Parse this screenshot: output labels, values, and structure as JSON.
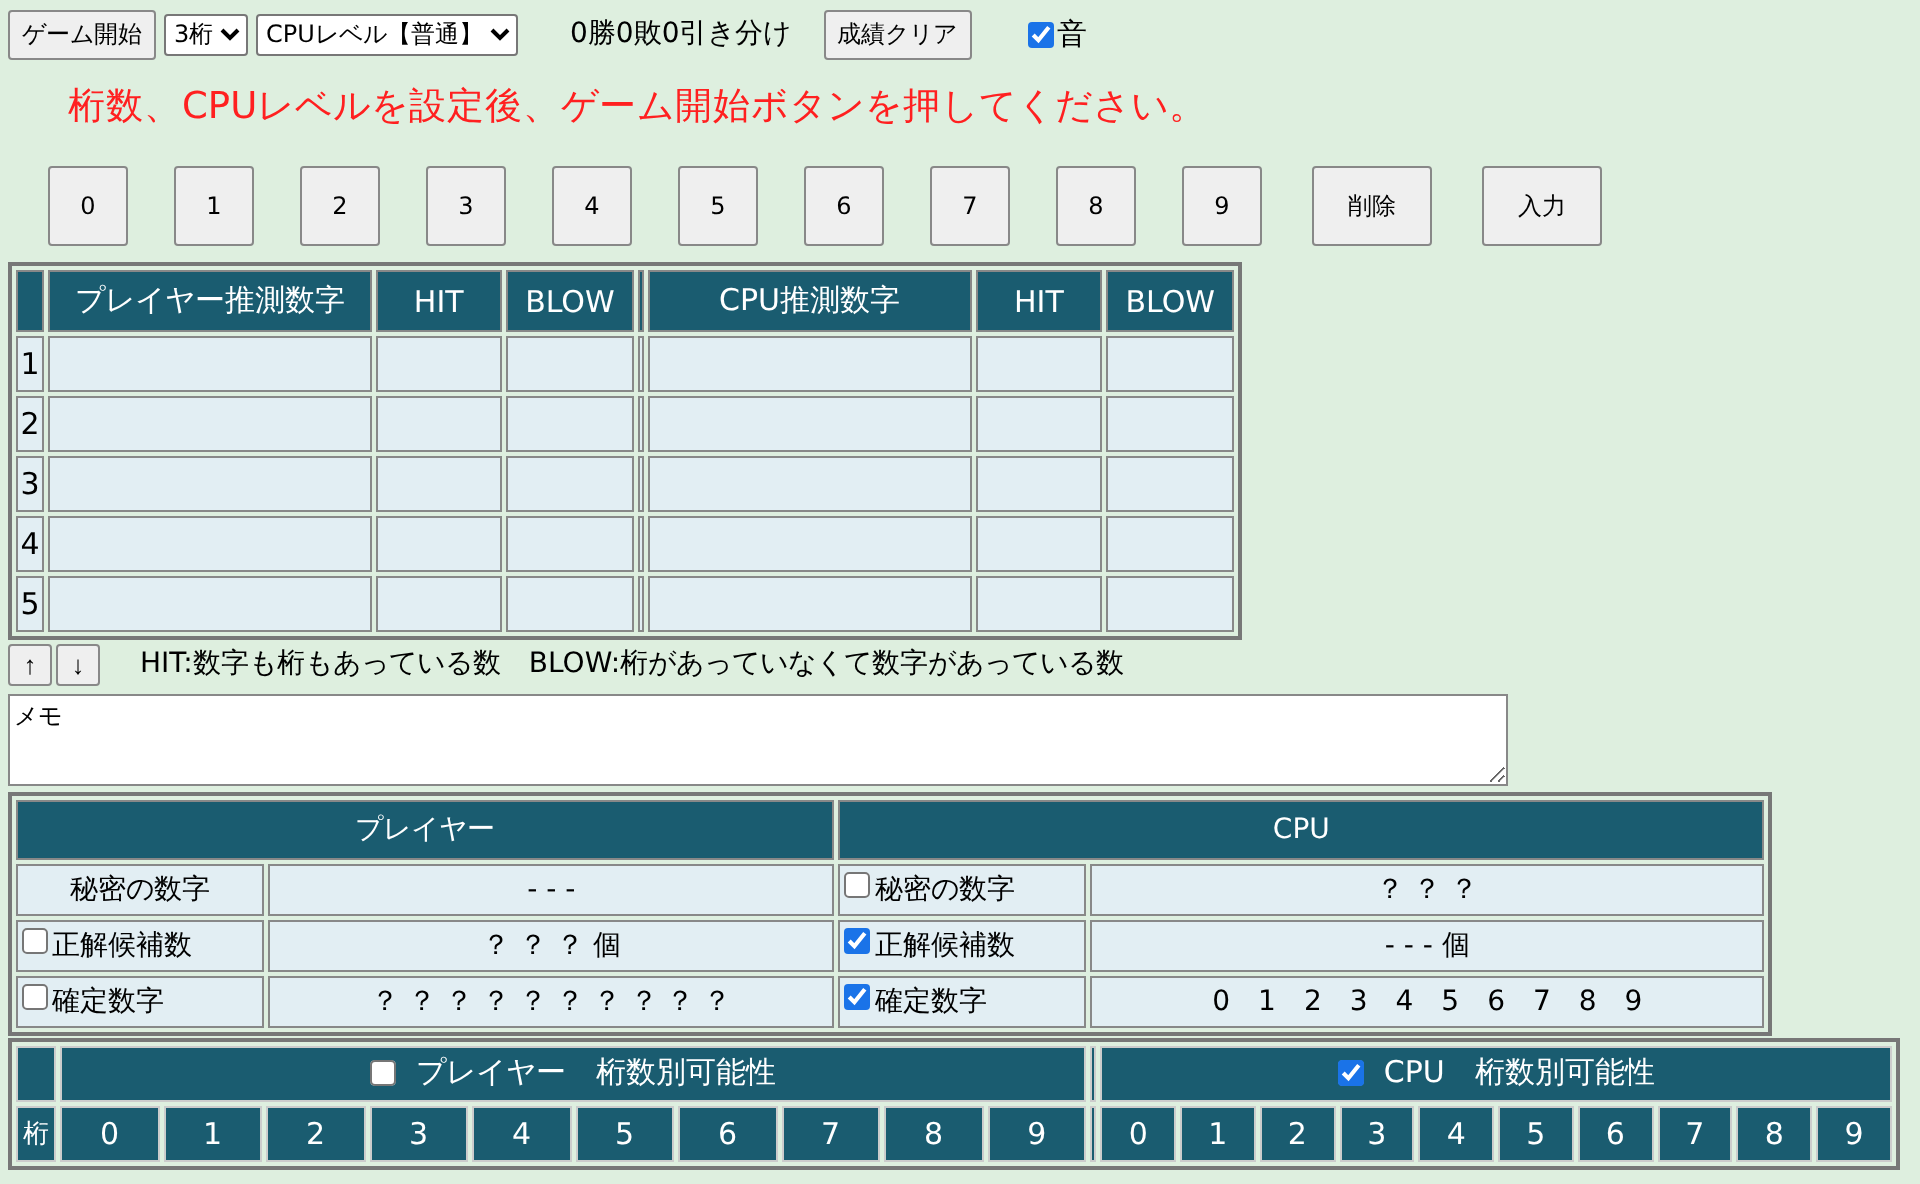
{
  "toolbar": {
    "start_button": "ゲーム開始",
    "digits_select": "3桁",
    "level_select": "CPUレベル【普通】",
    "record": "0勝0敗0引き分け",
    "clear_button": "成績クリア",
    "sound": {
      "label": "音",
      "checked": true
    }
  },
  "message": "桁数、CPUレベルを設定後、ゲーム開始ボタンを押してください。",
  "keypad": [
    "0",
    "1",
    "2",
    "3",
    "4",
    "5",
    "6",
    "7",
    "8",
    "9",
    "削除",
    "入力"
  ],
  "guess_table": {
    "player_columns": [
      "プレイヤー推測数字",
      "HIT",
      "BLOW"
    ],
    "cpu_columns": [
      "CPU推測数字",
      "HIT",
      "BLOW"
    ],
    "rows": [
      "1",
      "2",
      "3",
      "4",
      "5"
    ]
  },
  "scroll_buttons": [
    "↑",
    "↓"
  ],
  "legend": [
    "HIT:数字も桁もあっている数",
    "BLOW:桁があっていなくて数字があっている数"
  ],
  "memo": {
    "value": "メモ"
  },
  "info": {
    "sides": [
      {
        "title": "プレイヤー",
        "rows": [
          {
            "kind": "plain",
            "label": "秘密の数字",
            "value": "- - -"
          },
          {
            "kind": "check",
            "checked": false,
            "label": "正解候補数",
            "value": "？ ？ ？ 個"
          },
          {
            "kind": "check",
            "checked": false,
            "label": "確定数字",
            "value": "？ ？ ？ ？ ？ ？ ？ ？ ？ ？"
          }
        ]
      },
      {
        "title": "CPU",
        "rows": [
          {
            "kind": "check",
            "checked": false,
            "label": "秘密の数字",
            "value": "？ ？ ？"
          },
          {
            "kind": "check",
            "checked": true,
            "label": "正解候補数",
            "value": "- - - 個"
          },
          {
            "kind": "check",
            "checked": true,
            "label": "確定数字",
            "value": "0　1　2　3　4　5　6　7　8　9"
          }
        ]
      }
    ]
  },
  "possibility": {
    "corner": "桁",
    "sides": [
      {
        "title": "プレイヤー　桁数別可能性",
        "checked": false,
        "digits": [
          "0",
          "1",
          "2",
          "3",
          "4",
          "5",
          "6",
          "7",
          "8",
          "9"
        ]
      },
      {
        "title": "CPU　桁数別可能性",
        "checked": true,
        "digits": [
          "0",
          "1",
          "2",
          "3",
          "4",
          "5",
          "6",
          "7",
          "8",
          "9"
        ]
      }
    ]
  }
}
